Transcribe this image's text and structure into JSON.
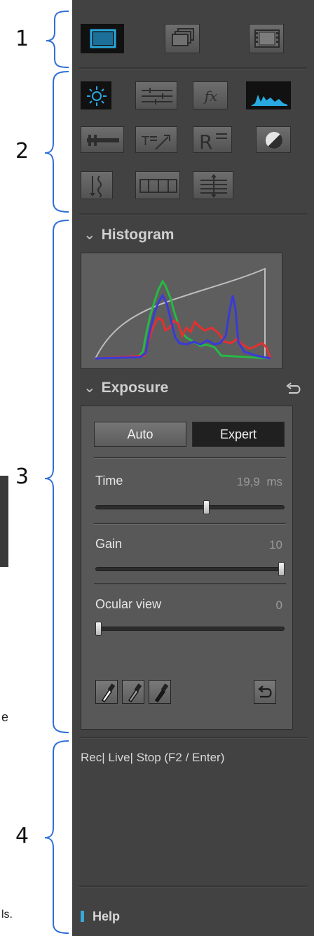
{
  "callouts": [
    "1",
    "2",
    "3",
    "4"
  ],
  "background_fragments": {
    "left_text": "e",
    "bottom_text": "ls."
  },
  "toolbar_modes": {
    "icons": [
      "single-frame-icon",
      "multi-frame-icon",
      "film-strip-icon"
    ],
    "active": "single-frame-icon"
  },
  "tool_grid": {
    "rows": [
      [
        "brightness-icon",
        "adjust-sliders-icon",
        "fx-icon",
        "histogram-icon"
      ],
      [
        "measure-icon",
        "text-annotation-icon",
        "report-icon",
        "contrast-icon"
      ],
      [
        "z-stack-icon",
        "frame-compare-icon",
        "align-icon"
      ]
    ],
    "fx_label": "fx",
    "report_label": "R",
    "active": [
      "brightness-icon",
      "histogram-icon"
    ]
  },
  "histogram": {
    "title": "Histogram",
    "colors": {
      "red": "#e53030",
      "green": "#27b845",
      "blue": "#3a3ad8",
      "curve": "#bdbdbd"
    }
  },
  "exposure": {
    "title": "Exposure",
    "modes": {
      "auto": "Auto",
      "expert": "Expert",
      "selected": "Expert"
    },
    "time": {
      "label": "Time",
      "value": "19,9",
      "unit": "ms",
      "slider_fraction": 0.59
    },
    "gain": {
      "label": "Gain",
      "value": "10",
      "slider_fraction": 1.0
    },
    "ocular": {
      "label": "Ocular view",
      "value": "0",
      "slider_fraction": 0.0
    },
    "pipettes": [
      "pipette-icon",
      "pipette-icon",
      "pipette-icon"
    ]
  },
  "record": {
    "text": "Rec| Live| Stop (F2 / Enter)"
  },
  "help": {
    "label": "Help",
    "accent": "#3aa7d8"
  }
}
